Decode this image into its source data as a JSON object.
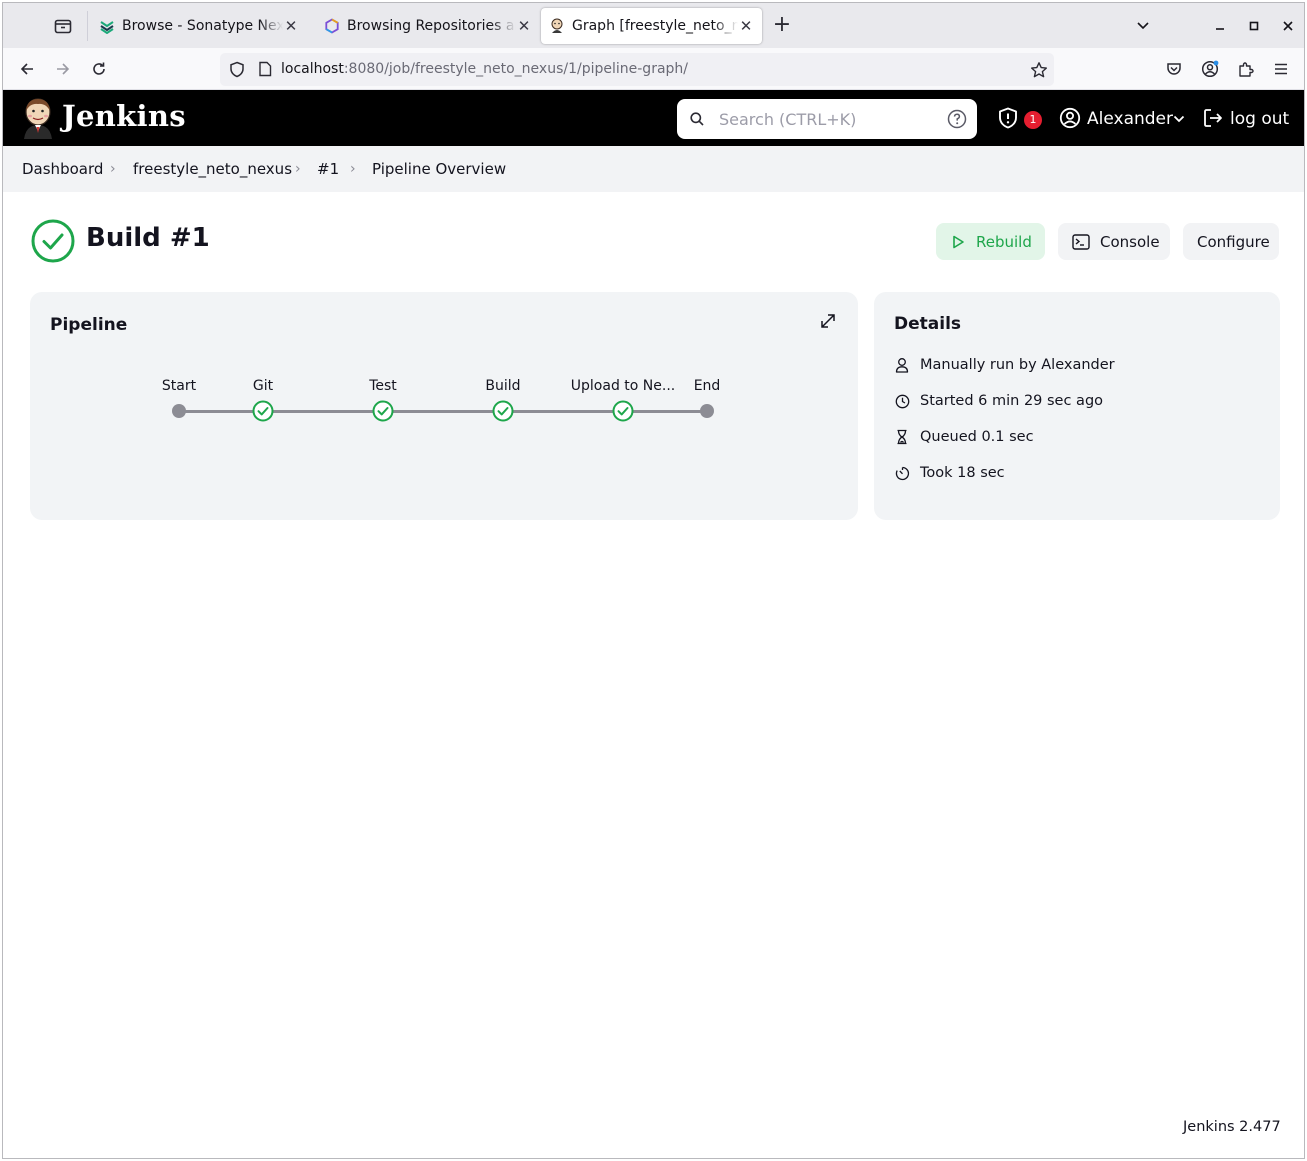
{
  "browser": {
    "tabs": [
      {
        "title": "Browse - Sonatype Nexus Repository",
        "icon": "nexus-icon",
        "active": false
      },
      {
        "title": "Browsing Repositories and Artifacts",
        "icon": "hexagon-icon",
        "active": false
      },
      {
        "title": "Graph [freestyle_neto_nexus]",
        "icon": "jenkins-icon",
        "active": true
      }
    ],
    "url_host": "localhost",
    "url_rest": ":8080/job/freestyle_neto_nexus/1/pipeline-graph/"
  },
  "header": {
    "app_name": "Jenkins",
    "search_placeholder": "Search (CTRL+K)",
    "security_count": "1",
    "user_name": "Alexander",
    "logout_label": "log out"
  },
  "breadcrumb": [
    {
      "label": "Dashboard"
    },
    {
      "label": "freestyle_neto_nexus"
    },
    {
      "label": "#1"
    },
    {
      "label": "Pipeline Overview"
    }
  ],
  "build": {
    "title": "Build #1",
    "status": "success",
    "status_color": "#1ea64b",
    "actions": {
      "rebuild": "Rebuild",
      "console": "Console",
      "configure": "Configure"
    }
  },
  "pipeline": {
    "title": "Pipeline",
    "stages": [
      {
        "label": "Start",
        "state": "node"
      },
      {
        "label": "Git",
        "state": "success"
      },
      {
        "label": "Test",
        "state": "success"
      },
      {
        "label": "Build",
        "state": "success"
      },
      {
        "label": "Upload to Ne...",
        "state": "success"
      },
      {
        "label": "End",
        "state": "node"
      }
    ]
  },
  "details": {
    "title": "Details",
    "items": [
      {
        "icon": "user-icon",
        "text": "Manually run by Alexander"
      },
      {
        "icon": "clock-icon",
        "text": "Started 6 min 29 sec ago"
      },
      {
        "icon": "hourglass-icon",
        "text": "Queued 0.1 sec"
      },
      {
        "icon": "timer-icon",
        "text": "Took 18 sec"
      }
    ]
  },
  "footer": {
    "version": "Jenkins 2.477"
  }
}
